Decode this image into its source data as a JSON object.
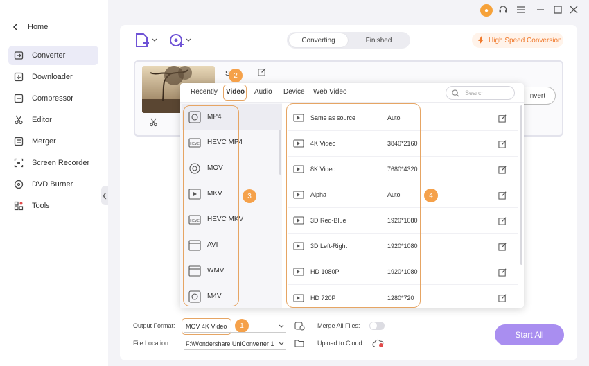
{
  "sidebar": {
    "home_label": "Home",
    "items": [
      {
        "label": "Converter",
        "icon": "converter-icon"
      },
      {
        "label": "Downloader",
        "icon": "downloader-icon"
      },
      {
        "label": "Compressor",
        "icon": "compressor-icon"
      },
      {
        "label": "Editor",
        "icon": "editor-icon"
      },
      {
        "label": "Merger",
        "icon": "merger-icon"
      },
      {
        "label": "Screen Recorder",
        "icon": "screen-recorder-icon"
      },
      {
        "label": "DVD Burner",
        "icon": "dvd-burner-icon"
      },
      {
        "label": "Tools",
        "icon": "tools-icon"
      }
    ]
  },
  "tabs": {
    "converting": "Converting",
    "finished": "Finished"
  },
  "high_speed": "High Speed Conversion",
  "file": {
    "name_partial": "S    se",
    "convert_partial": "nvert"
  },
  "popup": {
    "tabs": [
      "Recently",
      "Video",
      "Audio",
      "Device",
      "Web Video"
    ],
    "search_placeholder": "Search",
    "formats": [
      {
        "label": "MP4"
      },
      {
        "label": "HEVC MP4"
      },
      {
        "label": "MOV"
      },
      {
        "label": "MKV"
      },
      {
        "label": "HEVC MKV"
      },
      {
        "label": "AVI"
      },
      {
        "label": "WMV"
      },
      {
        "label": "M4V"
      }
    ],
    "resolutions": [
      {
        "name": "Same as source",
        "res": "Auto"
      },
      {
        "name": "4K Video",
        "res": "3840*2160"
      },
      {
        "name": "8K Video",
        "res": "7680*4320"
      },
      {
        "name": "Alpha",
        "res": "Auto"
      },
      {
        "name": "3D Red-Blue",
        "res": "1920*1080"
      },
      {
        "name": "3D Left-Right",
        "res": "1920*1080"
      },
      {
        "name": "HD 1080P",
        "res": "1920*1080"
      },
      {
        "name": "HD 720P",
        "res": "1280*720"
      }
    ]
  },
  "badges": {
    "b1": "1",
    "b2": "2",
    "b3": "3",
    "b4": "4"
  },
  "bottom": {
    "output_format_label": "Output Format:",
    "output_format_value": "MOV 4K Video",
    "merge_label": "Merge All Files:",
    "file_location_label": "File Location:",
    "file_location_value": "F:\\Wondershare UniConverter 1",
    "upload_label": "Upload to Cloud",
    "start_all": "Start All"
  },
  "colors": {
    "accent": "#a98ef0",
    "orange": "#f5a14a",
    "highlight": "#e6a564"
  }
}
